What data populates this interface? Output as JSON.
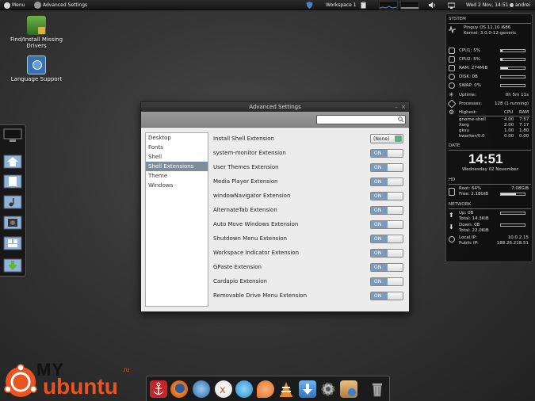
{
  "top_panel": {
    "menu_label": "Menu",
    "app_label": "Advanced Settings",
    "workspace_label": "Workspace 1",
    "clock": "Wed 2 Nov, 14:51",
    "user": "andrei"
  },
  "desktop": {
    "icons": [
      {
        "label": "Find/Install Missing Drivers",
        "icon": "drivers-lock-icon"
      },
      {
        "label": "Language Support",
        "icon": "language-flag-icon"
      }
    ]
  },
  "window": {
    "title": "Advanced Settings",
    "minimize_glyph": "–",
    "close_glyph": "×",
    "search_placeholder": "",
    "sidebar": [
      "Desktop",
      "Fonts",
      "Shell",
      "Shell Extensions",
      "Theme",
      "Windows"
    ],
    "selected_sidebar": "Shell Extensions",
    "install_label": "Install Shell Extension",
    "install_combo": "(None)",
    "extensions": [
      {
        "name": "system-monitor Extension",
        "state": "ON"
      },
      {
        "name": "User Themes Extension",
        "state": "ON"
      },
      {
        "name": "Media Player Extension",
        "state": "ON"
      },
      {
        "name": "windowNavigator Extension",
        "state": "ON"
      },
      {
        "name": "AlternateTab Extension",
        "state": "ON"
      },
      {
        "name": "Auto Move Windows Extension",
        "state": "ON"
      },
      {
        "name": "Shutdown Menu Extension",
        "state": "ON"
      },
      {
        "name": "Workspace Indicator Extension",
        "state": "ON"
      },
      {
        "name": "GPaste Extension",
        "state": "ON"
      },
      {
        "name": "Cardapio Extension",
        "state": "ON"
      },
      {
        "name": "Removable Drive Menu Extension",
        "state": "ON"
      }
    ]
  },
  "conky": {
    "system_head": "SYSTEM",
    "os": "Pinguy OS 11.10 i686",
    "kernel": "Kernel: 3.0.0-12-generic",
    "cpu1": "CPU1: 5%",
    "cpu2": "CPU2: 5%",
    "ram": "RAM: 274MiB",
    "disk": "DISK: 0B",
    "swap": "SWAP: 0%",
    "uptime_label": "Uptime:",
    "uptime": "0h 5m 11s",
    "processes_label": "Processes:",
    "processes": "128 (1 running)",
    "highest_label": "Highest:",
    "cpu_col": "CPU",
    "ram_col": "RAM",
    "procs": [
      {
        "name": "gnome-shell",
        "cpu": "4.00",
        "ram": "7.57"
      },
      {
        "name": "Xorg",
        "cpu": "2.00",
        "ram": "7.17"
      },
      {
        "name": "gksu",
        "cpu": "1.00",
        "ram": "1.80"
      },
      {
        "name": "kworker/0:0",
        "cpu": "0.00",
        "ram": "0.00"
      }
    ],
    "date_head": "DATE",
    "time": "14:51",
    "date": "Wednesday 02 November",
    "hd_head": "HD",
    "root": "Root: 64%",
    "root_size": "7.08GiB",
    "free": "Free: 2.18GiB",
    "network_head": "NETWORK",
    "up": "Up: 0B",
    "up_total": "Total: 14.3KiB",
    "down": "Down: 0B",
    "down_total": "Total: 22.0KiB",
    "local_ip_label": "Local IP:",
    "local_ip": "10.0.2.15",
    "public_ip_label": "Public IP:",
    "public_ip": "188.26.218.51",
    "cpu1_frac": 0.05,
    "cpu2_frac": 0.05,
    "ram_frac": 0.3,
    "disk_frac": 0.0,
    "swap_frac": 0.0,
    "root_frac": 0.64
  },
  "watermark": {
    "brand_top": "MY",
    "brand_bottom": "ubuntu",
    "tld": ".ru"
  },
  "colors": {
    "accent": "#7b99b9",
    "selection": "#7f8c99",
    "orange": "#e95420"
  }
}
